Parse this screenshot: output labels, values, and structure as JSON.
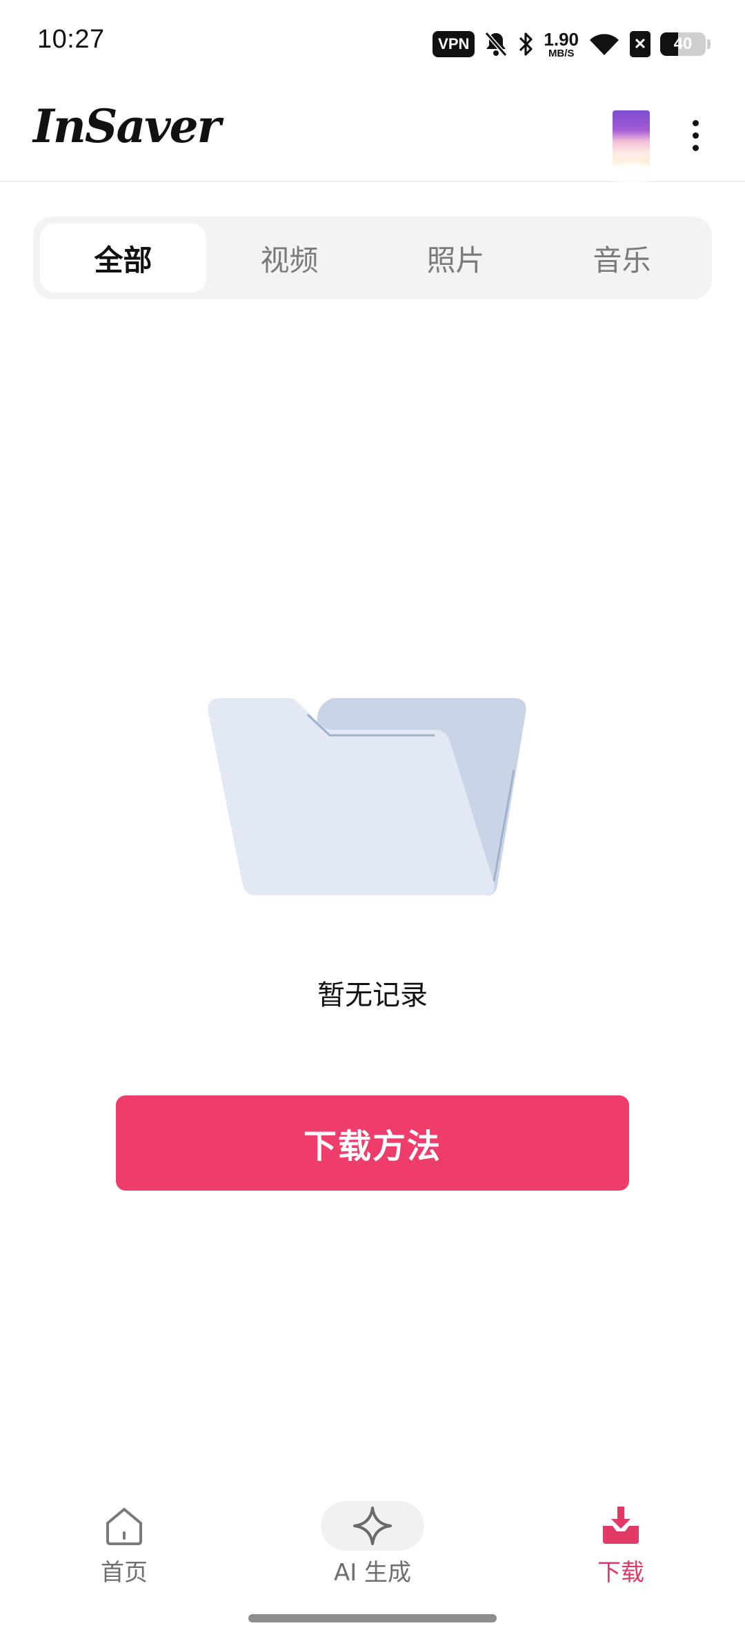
{
  "status_bar": {
    "time": "10:27",
    "vpn": "VPN",
    "net_speed_value": "1.90",
    "net_speed_unit": "MB/S",
    "battery": "40",
    "battery_level": 0.4
  },
  "app_bar": {
    "logo": "InSaver"
  },
  "tabs": [
    {
      "label": "全部",
      "active": true
    },
    {
      "label": "视频",
      "active": false
    },
    {
      "label": "照片",
      "active": false
    },
    {
      "label": "音乐",
      "active": false
    }
  ],
  "empty_state": {
    "message": "暂无记录",
    "button_label": "下载方法"
  },
  "bottom_nav": [
    {
      "label": "首页",
      "icon": "home-icon",
      "active": false
    },
    {
      "label": "AI 生成",
      "icon": "sparkle-icon",
      "active": false
    },
    {
      "label": "下载",
      "icon": "download-icon",
      "active": true
    }
  ],
  "colors": {
    "accent": "#ef3d6b",
    "nav_active": "#e23a66",
    "folder_front": "#e2e9f5",
    "folder_back": "#c9d5e6"
  }
}
